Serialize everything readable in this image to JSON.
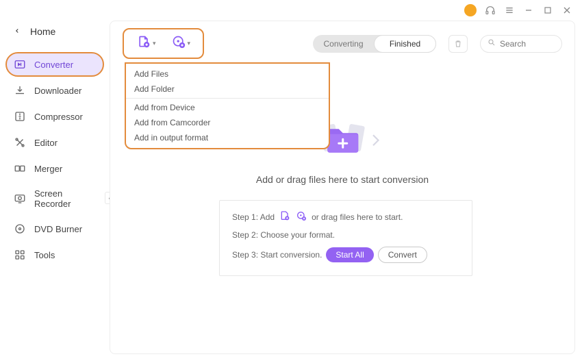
{
  "window": {
    "home_label": "Home"
  },
  "sidebar": {
    "items": [
      {
        "label": "Converter"
      },
      {
        "label": "Downloader"
      },
      {
        "label": "Compressor"
      },
      {
        "label": "Editor"
      },
      {
        "label": "Merger"
      },
      {
        "label": "Screen Recorder"
      },
      {
        "label": "DVD Burner"
      },
      {
        "label": "Tools"
      }
    ]
  },
  "topbar": {
    "segmented": {
      "converting": "Converting",
      "finished": "Finished"
    },
    "search_placeholder": "Search"
  },
  "add_menu": {
    "items": [
      "Add Files",
      "Add Folder",
      "Add from Device",
      "Add from Camcorder",
      "Add in output format"
    ]
  },
  "dropzone": {
    "text": "Add or drag files here to start conversion"
  },
  "steps": {
    "s1_pre": "Step 1: Add",
    "s1_post": "or drag files here to start.",
    "s2": "Step 2: Choose your format.",
    "s3": "Step 3: Start conversion.",
    "start_all": "Start All",
    "convert": "Convert"
  },
  "colors": {
    "accent": "#9362f2",
    "highlight_border": "#e38b3c",
    "avatar": "#f5a623"
  }
}
